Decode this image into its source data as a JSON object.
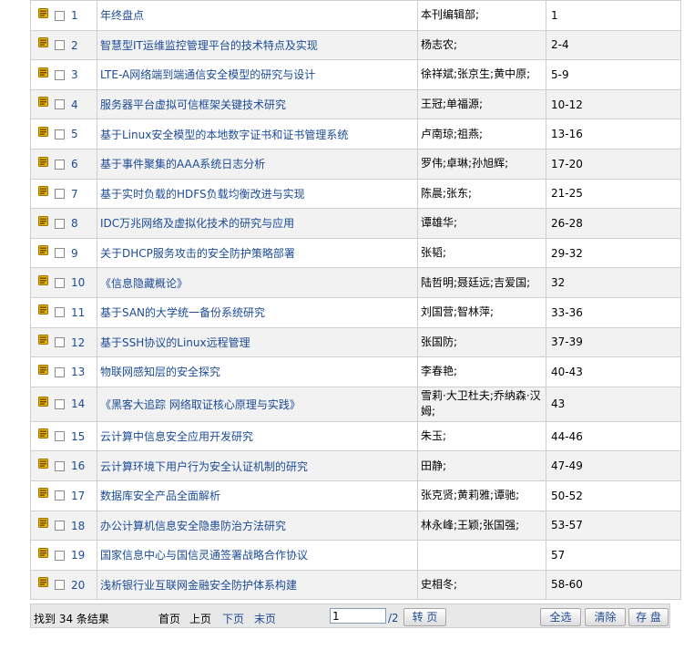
{
  "rows": [
    {
      "num": "1",
      "title": "年终盘点",
      "author": "本刊编辑部;",
      "pages": "1"
    },
    {
      "num": "2",
      "title": "智慧型IT运维监控管理平台的技术特点及实现",
      "author": "杨志农;",
      "pages": "2-4"
    },
    {
      "num": "3",
      "title": "LTE-A网络端到端通信安全模型的研究与设计",
      "author": "徐祥斌;张京生;黄中原;",
      "pages": "5-9"
    },
    {
      "num": "4",
      "title": "服务器平台虚拟可信框架关键技术研究",
      "author": "王冠;单福源;",
      "pages": "10-12"
    },
    {
      "num": "5",
      "title": "基于Linux安全模型的本地数字证书和证书管理系统",
      "author": "卢南琼;祖燕;",
      "pages": "13-16"
    },
    {
      "num": "6",
      "title": "基于事件聚集的AAA系统日志分析",
      "author": "罗伟;卓琳;孙旭辉;",
      "pages": "17-20"
    },
    {
      "num": "7",
      "title": "基于实时负载的HDFS负载均衡改进与实现",
      "author": "陈晨;张东;",
      "pages": "21-25"
    },
    {
      "num": "8",
      "title": "IDC万兆网络及虚拟化技术的研究与应用",
      "author": "谭雄华;",
      "pages": "26-28"
    },
    {
      "num": "9",
      "title": "关于DHCP服务攻击的安全防护策略部署",
      "author": "张韬;",
      "pages": "29-32"
    },
    {
      "num": "10",
      "title": "《信息隐藏概论》",
      "author": "陆哲明;聂廷远;吉爱国;",
      "pages": "32"
    },
    {
      "num": "11",
      "title": "基于SAN的大学统一备份系统研究",
      "author": "刘国营;智林萍;",
      "pages": "33-36"
    },
    {
      "num": "12",
      "title": "基于SSH协议的Linux远程管理",
      "author": "张国防;",
      "pages": "37-39"
    },
    {
      "num": "13",
      "title": "物联网感知层的安全探究",
      "author": "李春艳;",
      "pages": "40-43"
    },
    {
      "num": "14",
      "title": "《黑客大追踪 网络取证核心原理与实践》",
      "author": "雪莉·大卫杜夫;乔纳森·汉姆;",
      "pages": "43"
    },
    {
      "num": "15",
      "title": "云计算中信息安全应用开发研究",
      "author": "朱玉;",
      "pages": "44-46"
    },
    {
      "num": "16",
      "title": "云计算环境下用户行为安全认证机制的研究",
      "author": "田静;",
      "pages": "47-49"
    },
    {
      "num": "17",
      "title": "数据库安全产品全面解析",
      "author": "张克贤;黄莉雅;谭驰;",
      "pages": "50-52"
    },
    {
      "num": "18",
      "title": "办公计算机信息安全隐患防治方法研究",
      "author": "林永峰;王颖;张国强;",
      "pages": "53-57"
    },
    {
      "num": "19",
      "title": "国家信息中心与国信灵通签署战略合作协议",
      "author": "",
      "pages": "57"
    },
    {
      "num": "20",
      "title": "浅析银行业互联网金融安全防护体系构建",
      "author": "史相冬;",
      "pages": "58-60"
    }
  ],
  "footer": {
    "found": "找到 34 条结果",
    "first": "首页",
    "prev": "上页",
    "next": "下页",
    "last": "末页",
    "page_value": "1",
    "total": "/2",
    "go": "转 页",
    "select_all": "全选",
    "clear": "清除",
    "save": "存 盘"
  },
  "colors": {
    "link": "#1c4b96",
    "row_alt": "#f2f2f2",
    "icon": "#e8b400"
  }
}
